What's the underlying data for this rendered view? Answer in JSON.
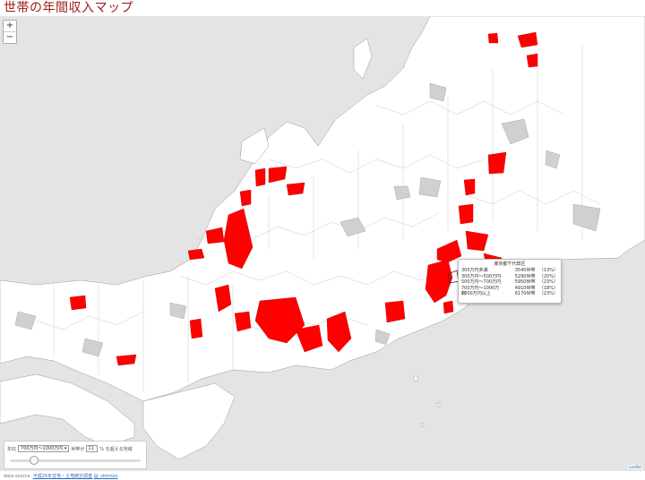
{
  "title": "世帯の年間収入マップ",
  "map": {
    "zoom_in": "+",
    "zoom_out": "−",
    "highlight_color": "#ff0000",
    "land_color": "#ffffff",
    "nodata_color": "#d0d0d0",
    "sea_color": "#e4e4e4"
  },
  "popup": {
    "title": "東京都千代田区",
    "rows": [
      {
        "label": "300万円未満",
        "count": "3540世帯",
        "pct": "（13%）"
      },
      {
        "label": "300万円～500万円",
        "count": "5290世帯",
        "pct": "（20%）"
      },
      {
        "label": "500万円～700万円",
        "count": "5950世帯",
        "pct": "（23%）"
      },
      {
        "label": "700万円～1000万円",
        "count": "4910世帯",
        "pct": "（18%）"
      },
      {
        "label": "1000万円以上",
        "count": "6170世帯",
        "pct": "（23%）"
      }
    ]
  },
  "control": {
    "income_label": "年収",
    "income_value": "700万円～1000万円",
    "households_label": "世帯が",
    "percent_value": "11",
    "suffix": "% を超える地域",
    "slider_level": 0.18
  },
  "footer": {
    "prefix": "data source:",
    "link_text": "平成25年住宅・土地統計調査",
    "author": "@_shimizu"
  },
  "attribution": "Leaflet"
}
